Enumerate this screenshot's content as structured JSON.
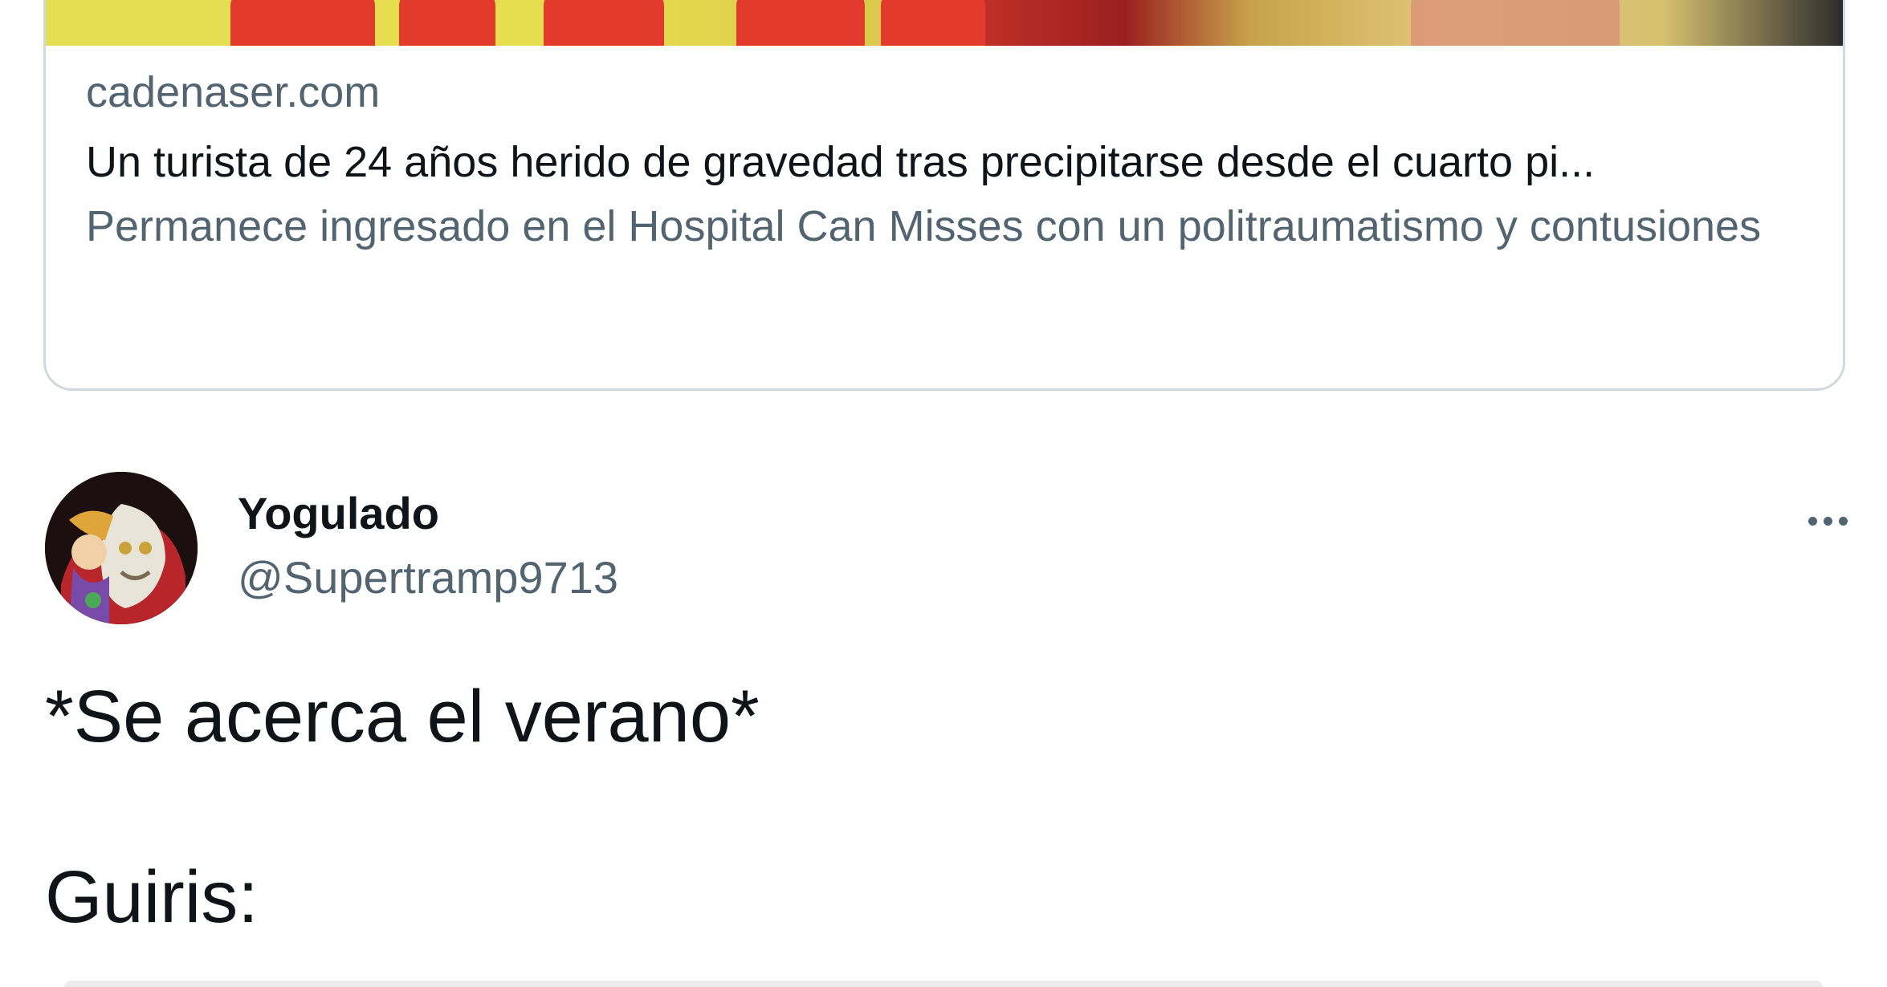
{
  "link_card": {
    "domain": "cadenaser.com",
    "title": "Un turista de 24 años herido de gravedad tras precipitarse desde el cuarto pi...",
    "description": "Permanece ingresado en el Hospital Can Misses con un politraumatismo y contusiones"
  },
  "tweet": {
    "display_name": "Yogulado",
    "handle": "@Supertramp9713",
    "more_icon": "more-horizontal-icon",
    "lines": [
      "*Se acerca el verano*",
      "Guiris:"
    ]
  },
  "colors": {
    "text_primary": "#0f1419",
    "text_secondary": "#536471",
    "card_border": "#cfd9de"
  }
}
